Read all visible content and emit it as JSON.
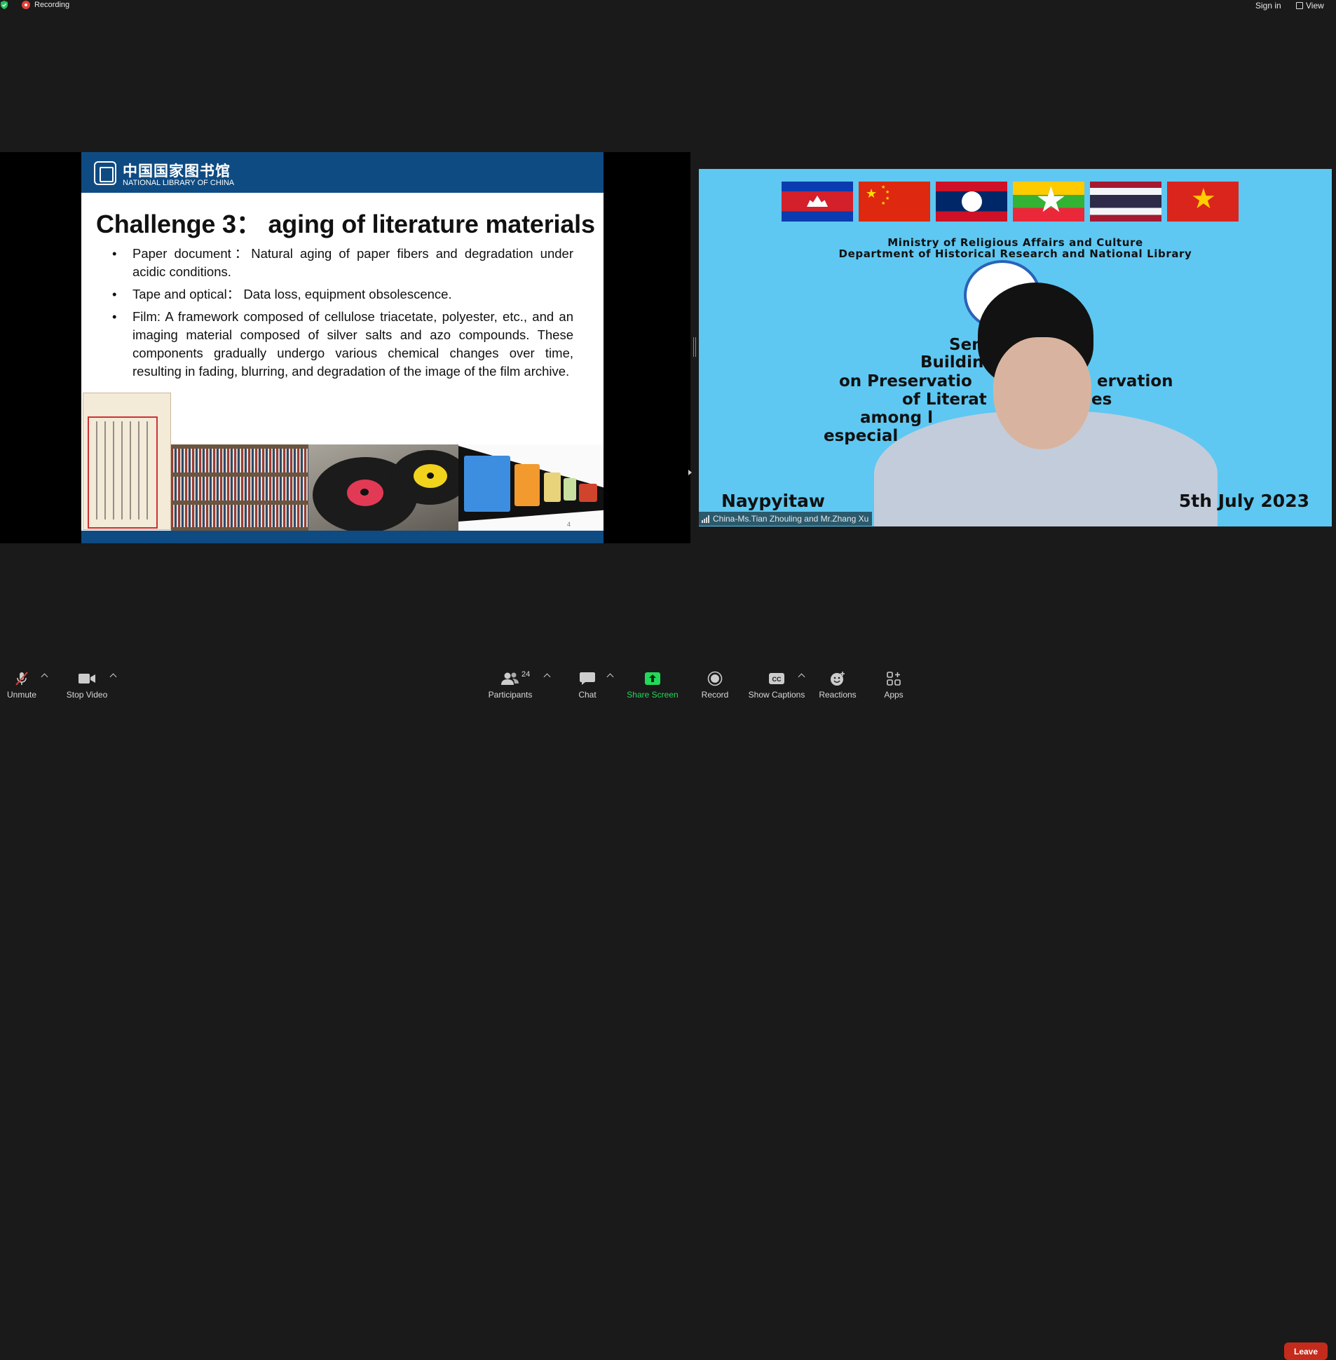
{
  "topbar": {
    "recording_label": "Recording",
    "signin_label": "Sign in",
    "view_label": "View"
  },
  "slide": {
    "logo_cn": "中国国家图书馆",
    "logo_en": "NATIONAL LIBRARY OF CHINA",
    "title": "Challenge 3： aging of literature materials",
    "bullets": [
      "Paper document：Natural aging of paper fibers and degradation under acidic conditions.",
      "Tape and optical： Data loss, equipment obsolescence.",
      "Film: A framework composed of cellulose triacetate, polyester, etc., and an imaging material composed of silver salts and azo compounds. These components gradually undergo various chemical changes over time, resulting in fading, blurring, and degradation of the image of the film archive."
    ],
    "page_number": "4"
  },
  "video": {
    "ministry_line1": "Ministry of Religious Affairs and Culture",
    "ministry_line2": "Department of Historical Research and National Library",
    "seminar_fragments": [
      "Sem",
      "Buildin",
      "on Preservatio",
      "ervation",
      "of Literat",
      "es",
      "among l",
      "especial",
      "ies"
    ],
    "location": "Naypyitaw",
    "date_fragment": "5th July 2023",
    "participant_name": "China-Ms.Tian Zhouling and Mr.Zhang Xu"
  },
  "toolbar": {
    "unmute": "Unmute",
    "stop_video": "Stop Video",
    "participants": "Participants",
    "participants_count": "24",
    "chat": "Chat",
    "share_screen": "Share Screen",
    "record": "Record",
    "show_captions": "Show Captions",
    "reactions": "Reactions",
    "apps": "Apps",
    "leave": "Leave"
  },
  "colors": {
    "background": "#1a1a1a",
    "slide_header": "#0e4b82",
    "share_green": "#23d959",
    "leave_red": "#c42b1c",
    "video_bg": "#5ec8f2"
  }
}
